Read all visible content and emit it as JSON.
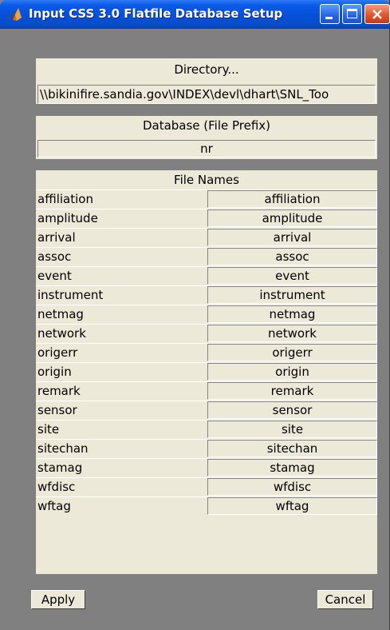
{
  "window": {
    "title": "Input CSS 3.0 Flatfile Database Setup",
    "icon": "matlab-icon"
  },
  "titlebar_buttons": {
    "minimize": "minimize-icon",
    "maximize": "maximize-icon",
    "close": "close-icon"
  },
  "directory": {
    "label": "Directory...",
    "value": "\\\\bikinifire.sandia.gov\\INDEX\\devl\\dhart\\SNL_Too"
  },
  "database": {
    "label": "Database (File Prefix)",
    "value": "nr"
  },
  "file_names": {
    "label": "File Names",
    "rows": [
      {
        "name": "affiliation",
        "value": "affiliation"
      },
      {
        "name": "amplitude",
        "value": "amplitude"
      },
      {
        "name": "arrival",
        "value": "arrival"
      },
      {
        "name": "assoc",
        "value": "assoc"
      },
      {
        "name": "event",
        "value": "event"
      },
      {
        "name": "instrument",
        "value": "instrument"
      },
      {
        "name": "netmag",
        "value": "netmag"
      },
      {
        "name": "network",
        "value": "network"
      },
      {
        "name": "origerr",
        "value": "origerr"
      },
      {
        "name": "origin",
        "value": "origin"
      },
      {
        "name": "remark",
        "value": "remark"
      },
      {
        "name": "sensor",
        "value": "sensor"
      },
      {
        "name": "site",
        "value": "site"
      },
      {
        "name": "sitechan",
        "value": "sitechan"
      },
      {
        "name": "stamag",
        "value": "stamag"
      },
      {
        "name": "wfdisc",
        "value": "wfdisc"
      },
      {
        "name": "wftag",
        "value": "wftag"
      }
    ]
  },
  "buttons": {
    "apply": "Apply",
    "cancel": "Cancel"
  },
  "colors": {
    "titlebar": "#0a56e0",
    "panel": "#ece9d8",
    "background": "#808080"
  }
}
